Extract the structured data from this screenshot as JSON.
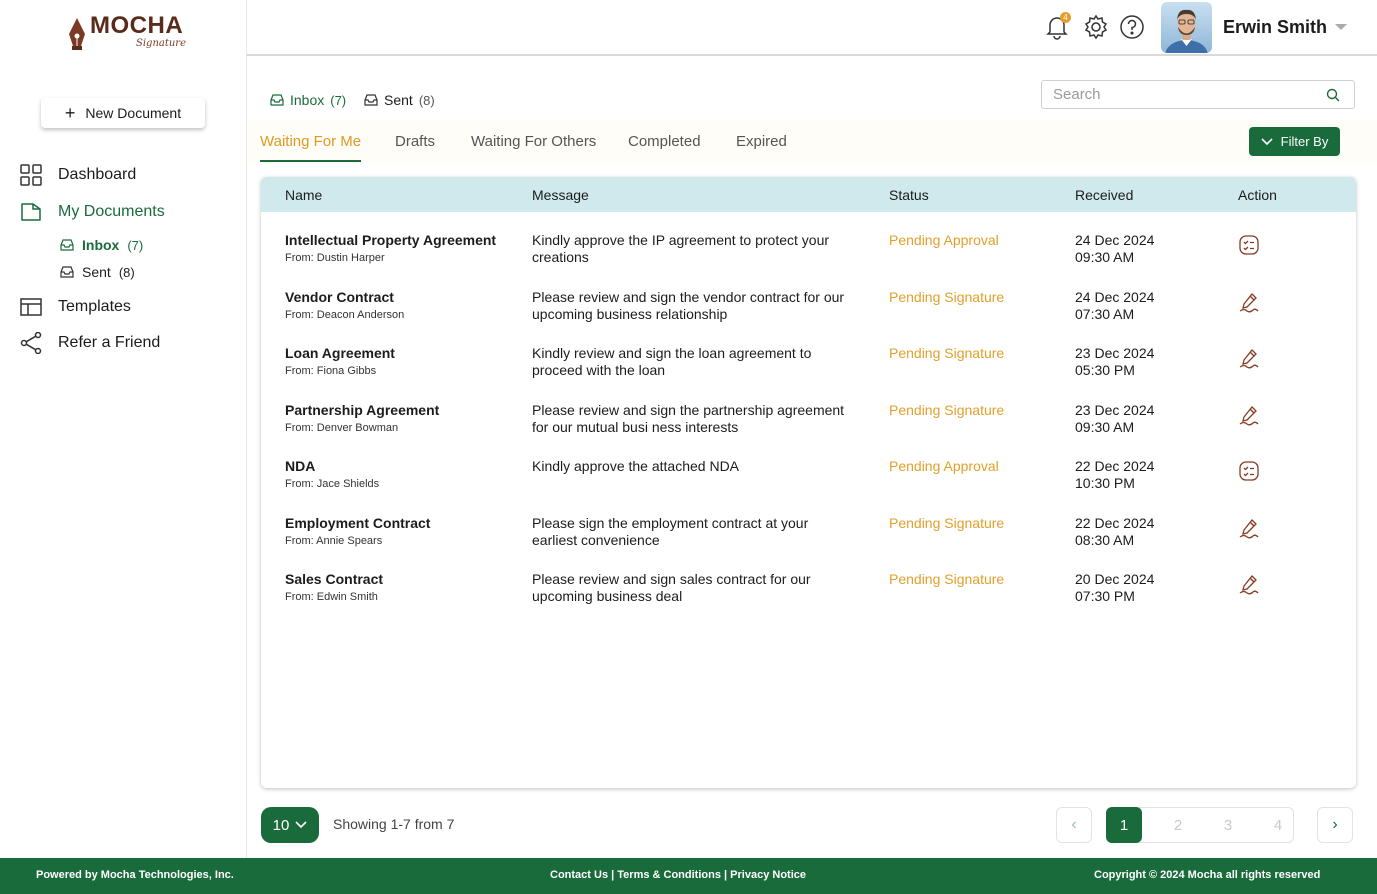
{
  "brand": {
    "name": "MOCHA",
    "script": "Signature"
  },
  "sidebar": {
    "new_document": "New Document",
    "items": [
      {
        "label": "Dashboard",
        "icon": "grid-icon"
      },
      {
        "label": "My Documents",
        "icon": "folder-icon"
      },
      {
        "label": "Templates",
        "icon": "template-icon"
      },
      {
        "label": "Refer a Friend",
        "icon": "share-icon"
      }
    ],
    "sub_items": [
      {
        "label": "Inbox",
        "count": "(7)"
      },
      {
        "label": "Sent",
        "count": "(8)"
      }
    ]
  },
  "header": {
    "notification_count": "4",
    "user_name": "Erwin Smith"
  },
  "main": {
    "folder_tabs": [
      {
        "label": "Inbox",
        "count": "(7)"
      },
      {
        "label": "Sent",
        "count": "(8)"
      }
    ],
    "search_placeholder": "Search",
    "tabs": [
      "Waiting For Me",
      "Drafts",
      "Waiting For Others",
      "Completed",
      "Expired"
    ],
    "filter_label": "Filter By",
    "columns": [
      "Name",
      "Message",
      "Status",
      "Received",
      "Action"
    ],
    "rows": [
      {
        "title": "Intellectual Property Agreement",
        "from": "From: Dustin Harper",
        "message": "Kindly approve the IP agreement to protect your creations",
        "status": "Pending Approval",
        "date": "24 Dec 2024",
        "time": "09:30 AM",
        "action": "checklist-icon"
      },
      {
        "title": "Vendor Contract",
        "from": "From: Deacon Anderson",
        "message": "Please review and sign the vendor contract for our upcoming business relationship",
        "status": "Pending  Signature",
        "date": "24 Dec 2024",
        "time": "07:30 AM",
        "action": "pen-icon"
      },
      {
        "title": "Loan Agreement",
        "from": "From: Fiona Gibbs",
        "message": "Kindly review and sign the loan agreement to proceed with the loan",
        "status": "Pending Signature",
        "date": "23 Dec 2024",
        "time": "05:30 PM",
        "action": "pen-icon"
      },
      {
        "title": "Partnership Agreement",
        "from": "From: Denver Bowman",
        "message": "Please review and sign the partnership agreement for our mutual busi      ness interests",
        "status": "Pending Signature",
        "date": "23 Dec 2024",
        "time": "09:30 AM",
        "action": "pen-icon"
      },
      {
        "title": "NDA",
        "from": "From: Jace Shields",
        "message": "Kindly approve the attached NDA",
        "status": "Pending Approval",
        "date": "22 Dec 2024",
        "time": "10:30 PM",
        "action": "checklist-icon"
      },
      {
        "title": "Employment Contract",
        "from": "From: Annie Spears",
        "message": "Please sign the employment contract at your earliest convenience",
        "status": "Pending Signature",
        "date": "22 Dec 2024",
        "time": "08:30 AM",
        "action": "pen-icon"
      },
      {
        "title": "Sales Contract",
        "from": "From: Edwin Smith",
        "message": "Please review and sign sales contract for our upcoming business deal",
        "status": "Pending Signature",
        "date": "20 Dec 2024",
        "time": "07:30 PM",
        "action": "pen-icon"
      }
    ],
    "pagination": {
      "per_page": "10",
      "showing": "Showing 1-7 from  7",
      "pages": [
        "1",
        "2",
        "3",
        "4"
      ],
      "current": "1"
    }
  },
  "footer": {
    "powered": "Powered by Mocha Technologies, Inc.",
    "contact": "Contact Us",
    "terms": "Terms & Conditions",
    "privacy": "Privacy Notice",
    "copyright": "Copyright © 2024 Mocha all rights reserved"
  },
  "colors": {
    "primary": "#1a6b3c",
    "accent": "#e2a02a",
    "header_row": "#cfe9ec",
    "brand": "#5a2b1b"
  }
}
